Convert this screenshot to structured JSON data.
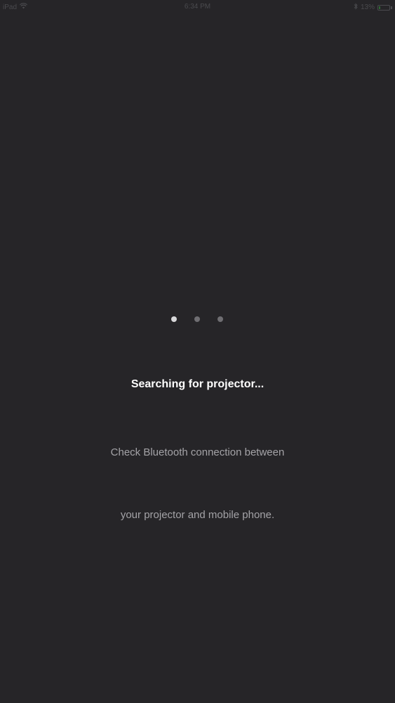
{
  "status_bar": {
    "device": "iPad",
    "time": "6:34 PM",
    "battery_percent": "13%",
    "battery_level": 0.13,
    "icons": [
      "wifi-icon",
      "bluetooth-icon",
      "battery-icon"
    ]
  },
  "pager": {
    "count": 3,
    "active_index": 0
  },
  "main": {
    "title": "Searching for projector...",
    "message_line1": "Check Bluetooth connection between",
    "message_line2": "your projector and mobile phone."
  },
  "colors": {
    "background": "#262528",
    "title": "#ffffff",
    "message": "#a4a3a7",
    "dot_active": "#d8d8da",
    "dot_inactive": "#6f6e72"
  }
}
